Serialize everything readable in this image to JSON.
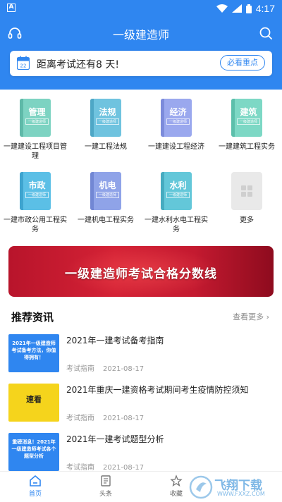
{
  "status_bar": {
    "time": "4:17",
    "carrier_icon": "A"
  },
  "header": {
    "title": "一级建造师",
    "left_icon": "headset-icon",
    "right_icon": "search-icon"
  },
  "countdown": {
    "calendar_day": "22",
    "text": "距离考试还有8 天!",
    "button": "必看重点"
  },
  "categories": [
    {
      "book_title": "管理",
      "book_sub": "一级建造师",
      "color": "#7dd3c2",
      "spine": "#5fb9a8",
      "label": "一建建设工程项目管理"
    },
    {
      "book_title": "法规",
      "book_sub": "一级建造师",
      "color": "#6fc3df",
      "spine": "#4ea7c6",
      "label": "一建工程法规"
    },
    {
      "book_title": "经济",
      "book_sub": "一级建造师",
      "color": "#9aa8ee",
      "spine": "#7c8bdb",
      "label": "一建建设工程经济"
    },
    {
      "book_title": "建筑",
      "book_sub": "一级建造师",
      "color": "#7dd8c5",
      "spine": "#5cbfab",
      "label": "一建建筑工程实务"
    },
    {
      "book_title": "市政",
      "book_sub": "一级建造师",
      "color": "#5bbfe6",
      "spine": "#3ea4cf",
      "label": "一建市政公用工程实务"
    },
    {
      "book_title": "机电",
      "book_sub": "一级建造师",
      "color": "#8fa3e8",
      "spine": "#7287d4",
      "label": "一建机电工程实务"
    },
    {
      "book_title": "水利",
      "book_sub": "一级建造师",
      "color": "#63c7d9",
      "spine": "#46abc0",
      "label": "一建水利水电工程实务"
    },
    {
      "book_title": "",
      "book_sub": "",
      "color": "#e9e9e9",
      "spine": "#e9e9e9",
      "label": "更多"
    }
  ],
  "banner": {
    "text": "一级建造师考试合格分数线"
  },
  "news_section": {
    "title": "推荐资讯",
    "more": "查看更多"
  },
  "news": [
    {
      "thumb_text": "2021年一级建造师考试备考方法，你值得拥有！",
      "thumb_bg": "#2f86f0",
      "title": "2021年一建考试备考指南",
      "category": "考试指南",
      "date": "2021-08-17"
    },
    {
      "thumb_text": "速看",
      "thumb_bg": "#f5d41c",
      "title": "2021年重庆一建资格考试期间考生疫情防控须知",
      "category": "考试指南",
      "date": "2021-08-17"
    },
    {
      "thumb_text": "重磅消息！2021年一级建造师考试各个题型分析",
      "thumb_bg": "#2f86f0",
      "title": "2021年一建考试题型分析",
      "category": "考试指南",
      "date": "2021-08-17"
    }
  ],
  "bottom_nav": [
    {
      "label": "首页",
      "icon": "home-icon"
    },
    {
      "label": "头条",
      "icon": "document-icon"
    },
    {
      "label": "收藏",
      "icon": "star-icon"
    }
  ],
  "watermark": {
    "text": "飞翔下载",
    "url": "WWW.FXXZ.COM"
  }
}
